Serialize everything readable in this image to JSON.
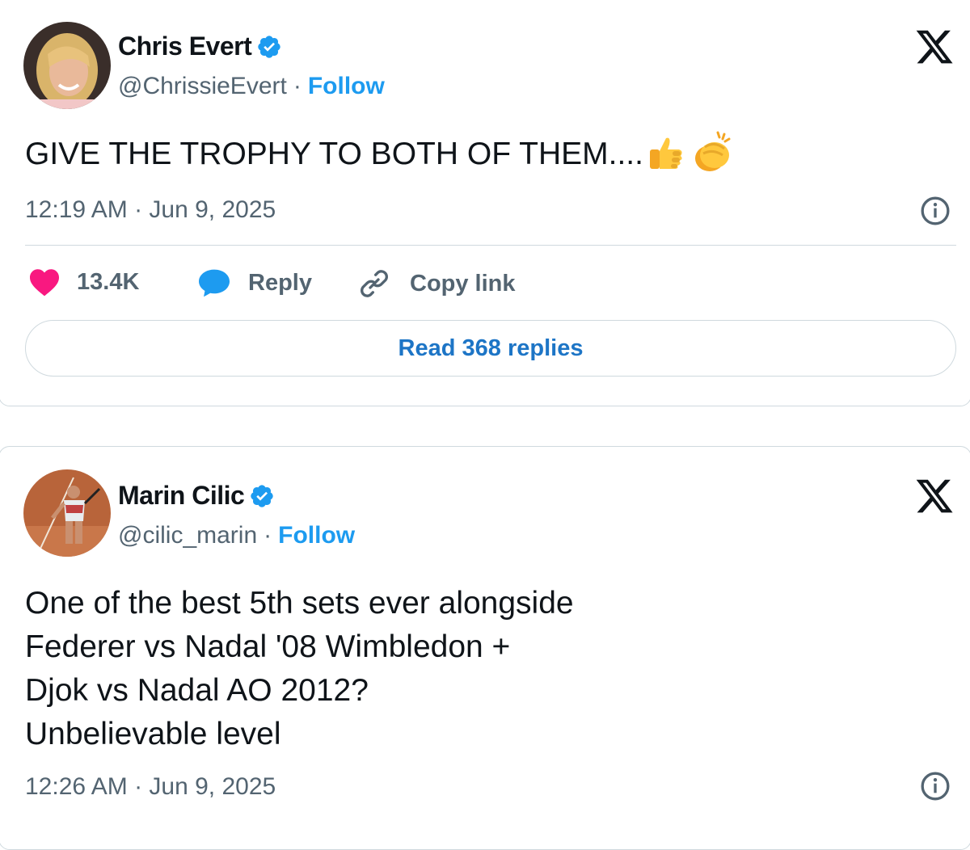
{
  "tweets": [
    {
      "author": "Chris Evert",
      "handle": "@ChrissieEvert",
      "separator": "·",
      "follow_label": "Follow",
      "text": "GIVE THE TROPHY TO BOTH OF THEM....",
      "emojis": [
        "thumbs-up",
        "clapping-hands"
      ],
      "timestamp": "12:19 AM · Jun 9, 2025",
      "likes": "13.4K",
      "reply_label": "Reply",
      "copy_link_label": "Copy link",
      "read_replies_label": "Read 368 replies"
    },
    {
      "author": "Marin Cilic",
      "handle": "@cilic_marin",
      "separator": "·",
      "follow_label": "Follow",
      "text_lines": [
        "One of the best 5th sets ever alongside",
        "Federer vs Nadal '08 Wimbledon +",
        "Djok vs Nadal AO 2012?",
        "Unbelievable level"
      ],
      "timestamp": "12:26 AM · Jun 9, 2025"
    }
  ],
  "colors": {
    "accent": "#1d9bf0",
    "like": "#f91880",
    "text_secondary": "#536471",
    "border": "#cfd9de"
  }
}
